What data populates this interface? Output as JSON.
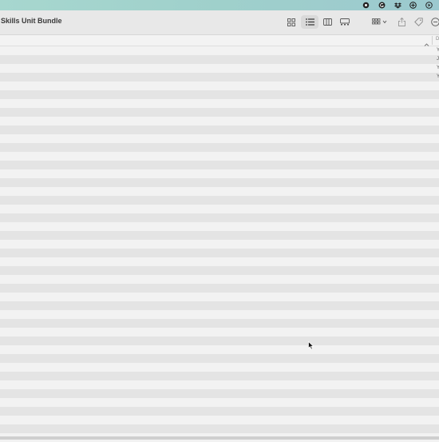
{
  "window": {
    "title": "Skills Unit Bundle"
  },
  "menubar": {
    "icons": [
      "record-icon",
      "grammarly-icon",
      "dropbox-icon",
      "vpn-icon",
      "play-icon"
    ]
  },
  "toolbar": {
    "views": [
      "icon-view",
      "list-view",
      "column-view",
      "gallery-view"
    ],
    "active_view": "list-view",
    "group_button": "group-icon",
    "share_button": "share-icon",
    "tags_button": "tag-icon",
    "more_button": "more-icon"
  },
  "header": {
    "sort_indicator": "chevron-up-icon",
    "columns": [
      "D"
    ]
  },
  "file_list": {
    "rows": [
      {
        "date": "Y"
      },
      {
        "date": "J"
      },
      {
        "date": "Y"
      },
      {
        "date": "Y"
      }
    ]
  }
}
